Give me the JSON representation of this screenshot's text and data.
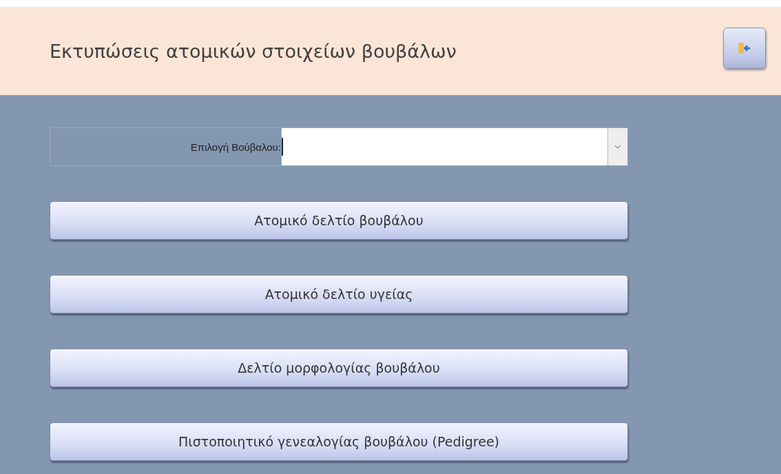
{
  "header": {
    "title": "Εκτυπώσεις ατομικών στοιχείων βουβάλων"
  },
  "selector": {
    "label": "Επιλογή Βούβαλου:"
  },
  "buttons": [
    "Ατομικό δελτίο βουβάλου",
    "Ατομικό δελτίο υγείας",
    "Δελτίο μορφολογίας βουβάλου",
    "Πιστοποιητικό γενεαλογίας βουβάλου (Pedigree)"
  ]
}
